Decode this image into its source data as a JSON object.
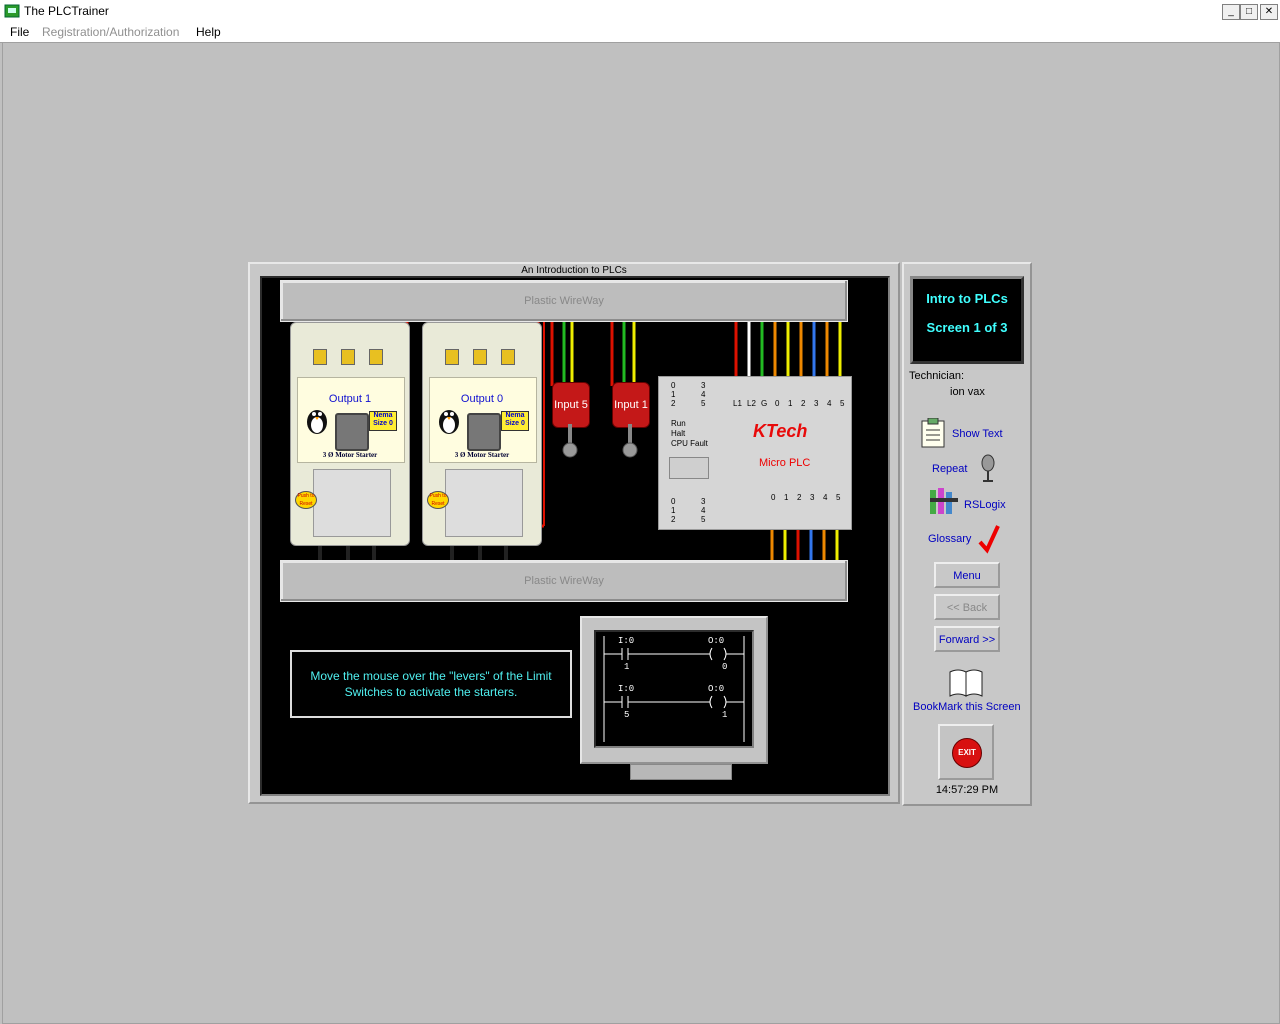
{
  "window": {
    "title": "The PLCTrainer",
    "min_label": "_",
    "max_label": "□",
    "close_label": "✕"
  },
  "menu": {
    "file": "File",
    "registration": "Registration/Authorization",
    "help": "Help"
  },
  "panel": {
    "title": "An Introduction to PLCs",
    "wireway_top": "Plastic WireWay",
    "wireway_bottom": "Plastic WireWay"
  },
  "starters": [
    {
      "label": "Output 1",
      "nema": "Nema Size 0",
      "caption": "3 Ø Motor Starter",
      "push": "Push to Reset"
    },
    {
      "label": "Output 0",
      "nema": "Nema Size 0",
      "caption": "3 Ø Motor Starter",
      "push": "Push to Reset"
    }
  ],
  "switches": [
    {
      "label": "Input 5"
    },
    {
      "label": "Input 1"
    }
  ],
  "plc": {
    "brand": "KTech",
    "model": "Micro PLC",
    "led_top_left": [
      "0",
      "1",
      "2"
    ],
    "led_top_right": [
      "3",
      "4",
      "5"
    ],
    "status": [
      "Run",
      "Halt",
      "CPU Fault"
    ],
    "led_bot_left": [
      "0",
      "1",
      "2"
    ],
    "led_bot_right": [
      "3",
      "4",
      "5"
    ],
    "input_terms": [
      "L1",
      "L2",
      "G",
      "0",
      "1",
      "2",
      "3",
      "4",
      "5"
    ],
    "output_terms": [
      "0",
      "1",
      "2",
      "3",
      "4",
      "5"
    ]
  },
  "instruction": "Move the mouse over the \"levers\" of the Limit Switches to activate the starters.",
  "ladder": {
    "rung1": {
      "in_addr": "I:0",
      "in_bit": "1",
      "out_addr": "O:0",
      "out_bit": "0"
    },
    "rung2": {
      "in_addr": "I:0",
      "in_bit": "5",
      "out_addr": "O:0",
      "out_bit": "1"
    }
  },
  "side": {
    "box_line1": "Intro to PLCs",
    "box_line2": "Screen 1 of 3",
    "technician_label": "Technician:",
    "technician_name": "ion vax",
    "show_text": "Show Text",
    "repeat": "Repeat",
    "rslogix": "RSLogix",
    "glossary": "Glossary",
    "menu_btn": "Menu",
    "back_btn": "<< Back",
    "forward_btn": "Forward >>",
    "bookmark": "BookMark this Screen",
    "exit": "EXIT",
    "time": "14:57:29 PM"
  },
  "colors": {
    "accent_cyan": "#40ffff",
    "link_blue": "#0000c0",
    "switch_red": "#c41818"
  }
}
